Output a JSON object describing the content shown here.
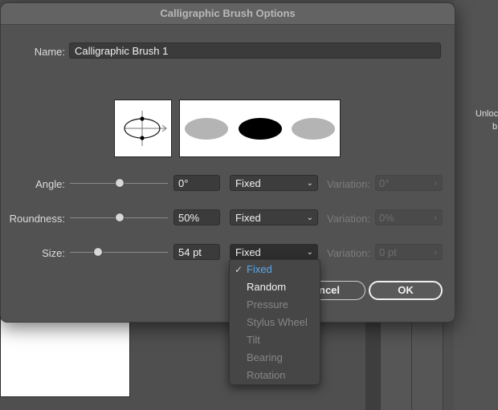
{
  "background": {
    "right_panel_text_line1": "Unloc",
    "right_panel_text_line2": "b"
  },
  "dialog": {
    "title": "Calligraphic Brush Options",
    "name_label": "Name:",
    "name_value": "Calligraphic Brush 1",
    "rows": [
      {
        "label": "Angle:",
        "value": "0°",
        "mode": "Fixed",
        "variation_label": "Variation:",
        "variation_value": "0°",
        "slider_fraction": 0.5
      },
      {
        "label": "Roundness:",
        "value": "50%",
        "mode": "Fixed",
        "variation_label": "Variation:",
        "variation_value": "0%",
        "slider_fraction": 0.5
      },
      {
        "label": "Size:",
        "value": "54 pt",
        "mode": "Fixed",
        "variation_label": "Variation:",
        "variation_value": "0 pt",
        "slider_fraction": 0.27
      }
    ],
    "cancel_label": "Cancel",
    "cancel_visible_text": "ncel",
    "ok_label": "OK"
  },
  "dropdown": {
    "selected": "Fixed",
    "items": [
      {
        "label": "Fixed",
        "state": "selected"
      },
      {
        "label": "Random",
        "state": "enabled"
      },
      {
        "label": "Pressure",
        "state": "disabled"
      },
      {
        "label": "Stylus Wheel",
        "state": "disabled"
      },
      {
        "label": "Tilt",
        "state": "disabled"
      },
      {
        "label": "Bearing",
        "state": "disabled"
      },
      {
        "label": "Rotation",
        "state": "disabled"
      }
    ]
  },
  "colors": {
    "selected_item": "#5aa9f0",
    "enabled_item": "#f2f2f2",
    "disabled_item": "#868686",
    "preview_gray": "#b4b4b4",
    "preview_black": "#000000"
  }
}
